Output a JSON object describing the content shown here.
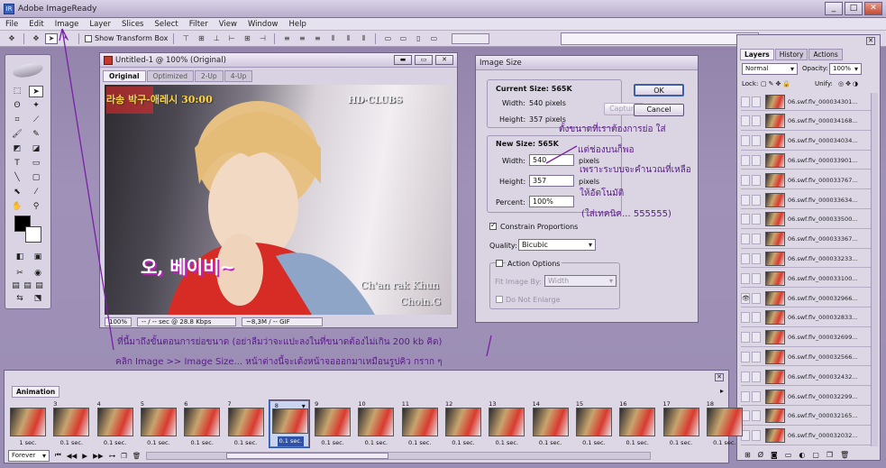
{
  "window": {
    "title": "Adobe ImageReady",
    "min": "_",
    "max": "□",
    "close": "✕"
  },
  "menu": [
    "File",
    "Edit",
    "Image",
    "Layer",
    "Slices",
    "Select",
    "Filter",
    "View",
    "Window",
    "Help"
  ],
  "options_bar": {
    "show_transform_box": "Show Transform Box"
  },
  "document": {
    "title": "Untitled-1 @ 100% (Original)",
    "tabs": [
      "Original",
      "Optimized",
      "2-Up",
      "4-Up"
    ],
    "active_tab": "Original",
    "zoom": "100%",
    "speed": "-- / -- sec @ 28.8 Kbps",
    "size": "~8,3M / -- GIF",
    "watermark_top": "HD·CLUBS",
    "watermark_line1": "Ch'an rak Khun",
    "watermark_line2": "Choin.G",
    "caption": "오, 베이비~"
  },
  "dialog": {
    "title": "Image Size",
    "current_size": "Current Size: 565K",
    "width_label": "Width:",
    "width_value": "540 pixels",
    "height_label": "Height:",
    "height_value": "357 pixels",
    "new_size": "New Size: 565K",
    "new_width_label": "Width:",
    "new_width": "540",
    "new_height_label": "Height:",
    "new_height": "357",
    "percent_label": "Percent:",
    "percent": "100%",
    "unit": "pixels",
    "constrain": "Constrain Proportions",
    "quality_label": "Quality:",
    "quality": "Bicubic",
    "action_options": "Action Options",
    "fit_label": "Fit Image By:",
    "fit_value": "Width",
    "do_not_enlarge": "Do Not Enlarge",
    "ok": "OK",
    "cancel": "Cancel",
    "capture": "Capture"
  },
  "annotations": {
    "note1": "ตั้งขนาดที่เราต้องการย่อ ใส่",
    "note2": "แต่ช่องบนก็พอ",
    "note3": "เพราะระบบจะคำนวณที่เหลือ",
    "note4": "ให้อัตโนมัติ",
    "note5": "(ใส่เทคนิค... 555555)",
    "bottom1": "ที่นี้มาถึงขั้นตอนการย่อขนาด (อย่าลืมว่าจะแปะลงในที่ขนาดต้องไม่เกิน 200 kb คิด)",
    "bottom2": "คลิก Image >> Image Size...   หน้าต่างนี้จะเด้งหน้าจอออกมาเหมือนรูปคิว กราก ๆ"
  },
  "layers_panel": {
    "tabs": [
      "Layers",
      "History",
      "Actions"
    ],
    "blend": "Normal",
    "opacity_label": "Opacity:",
    "opacity": "100%",
    "lock_label": "Lock:",
    "unify_label": "Unify:",
    "rows": [
      "06.swf.flv_000034301...",
      "06.swf.flv_000034168...",
      "06.swf.flv_000034034...",
      "06.swf.flv_000033901...",
      "06.swf.flv_000033767...",
      "06.swf.flv_000033634...",
      "06.swf.flv_000033500...",
      "06.swf.flv_000033367...",
      "06.swf.flv_000033233...",
      "06.swf.flv_000033100...",
      "06.swf.flv_000032966...",
      "06.swf.flv_000032833...",
      "06.swf.flv_000032699...",
      "06.swf.flv_000032566...",
      "06.swf.flv_000032432...",
      "06.swf.flv_000032299...",
      "06.swf.flv_000032165...",
      "06.swf.flv_000032032..."
    ],
    "visible_row": 10
  },
  "animation": {
    "tab": "Animation",
    "frames": [
      "",
      "3",
      "4",
      "5",
      "6",
      "7",
      "8",
      "9",
      "10",
      "11",
      "12",
      "13",
      "14",
      "15",
      "16",
      "17",
      "18"
    ],
    "delays": [
      "1 sec.",
      "0.1 sec.",
      "0.1 sec.",
      "0.1 sec.",
      "0.1 sec.",
      "0.1 sec.",
      "0.1 sec.",
      "0.1 sec.",
      "0.1 sec.",
      "0.1 sec.",
      "0.1 sec.",
      "0.1 sec.",
      "0.1 sec.",
      "0.1 sec.",
      "0.1 sec.",
      "0.1 sec.",
      "0.1 sec."
    ],
    "selected": 6,
    "loop": "Forever"
  }
}
